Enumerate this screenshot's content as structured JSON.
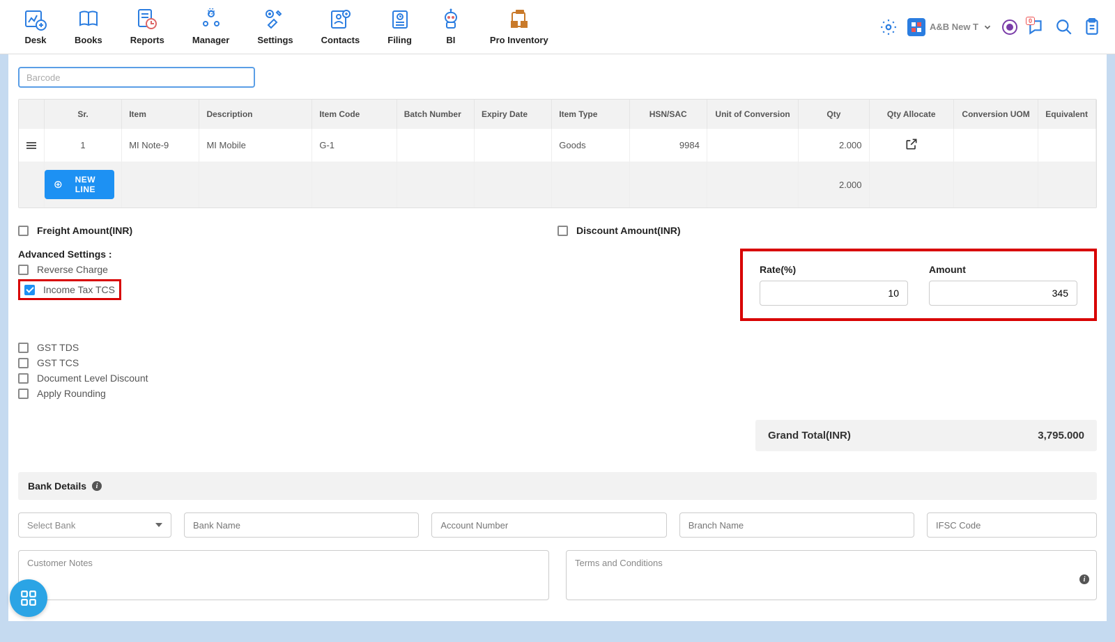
{
  "nav": {
    "items": [
      {
        "label": "Desk"
      },
      {
        "label": "Books"
      },
      {
        "label": "Reports"
      },
      {
        "label": "Manager"
      },
      {
        "label": "Settings"
      },
      {
        "label": "Contacts"
      },
      {
        "label": "Filing"
      },
      {
        "label": "BI"
      },
      {
        "label": "Pro Inventory"
      }
    ],
    "org_label": "A&B New T",
    "notif_count": "0"
  },
  "barcode": {
    "placeholder": "Barcode"
  },
  "table": {
    "headers": [
      "",
      "Sr.",
      "Item",
      "Description",
      "Item Code",
      "Batch Number",
      "Expiry Date",
      "Item Type",
      "HSN/SAC",
      "Unit of Conversion",
      "Qty",
      "Qty Allocate",
      "Conversion UOM",
      "Equivalent"
    ],
    "row": {
      "sr": "1",
      "item": "MI Note-9",
      "description": "MI Mobile",
      "item_code": "G-1",
      "batch": "",
      "expiry": "",
      "item_type": "Goods",
      "hsn": "9984",
      "uoc": "",
      "qty": "2.000",
      "conv_uom": "",
      "equiv": ""
    },
    "totals": {
      "qty": "2.000"
    },
    "new_line": "NEW LINE"
  },
  "opts": {
    "freight": "Freight Amount(INR)",
    "discount": "Discount Amount(INR)",
    "adv_heading": "Advanced Settings :",
    "reverse": "Reverse Charge",
    "income_tcs": "Income Tax TCS",
    "gst_tds": "GST TDS",
    "gst_tcs": "GST TCS",
    "doc_disc": "Document Level Discount",
    "apply_round": "Apply Rounding"
  },
  "tcs": {
    "rate_label": "Rate(%)",
    "rate_value": "10",
    "amount_label": "Amount",
    "amount_value": "345"
  },
  "grand": {
    "label": "Grand Total(INR)",
    "value": "3,795.000"
  },
  "bank": {
    "heading": "Bank Details",
    "select": "Select Bank",
    "name_ph": "Bank Name",
    "acct_ph": "Account Number",
    "branch_ph": "Branch Name",
    "ifsc_ph": "IFSC Code",
    "notes_ph": "Customer Notes",
    "terms_ph": "Terms and Conditions"
  }
}
